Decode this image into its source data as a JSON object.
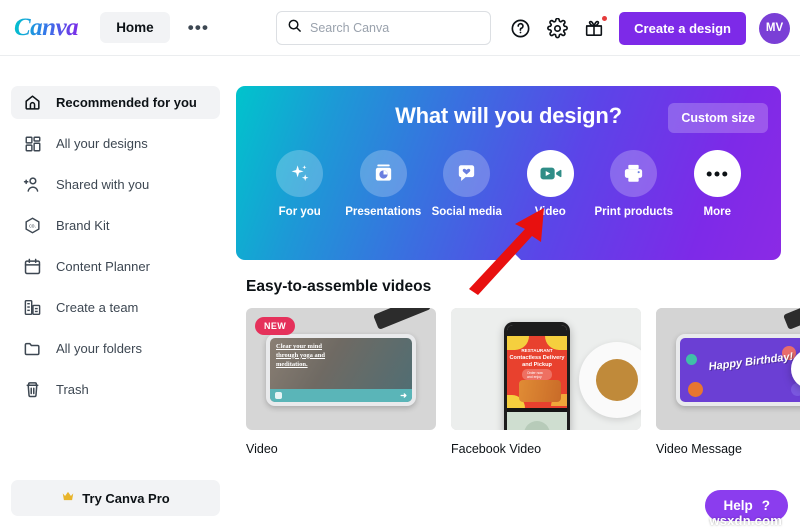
{
  "header": {
    "logo_text": "Canva",
    "nav_home": "Home",
    "nav_more": "•••",
    "search": {
      "value": "",
      "placeholder": "Search Canva"
    },
    "icons": [
      {
        "name": "help-circle-icon",
        "label": "?"
      },
      {
        "name": "gear-icon",
        "label": "settings"
      },
      {
        "name": "gift-icon",
        "label": "gift"
      }
    ],
    "create_button": "Create a design",
    "avatar_initials": "MV"
  },
  "sidebar": {
    "items": [
      {
        "label": "Recommended for you",
        "icon": "home-icon",
        "active": true
      },
      {
        "label": "All your designs",
        "icon": "grid-icon",
        "active": false
      },
      {
        "label": "Shared with you",
        "icon": "add-user-icon",
        "active": false
      },
      {
        "label": "Brand Kit",
        "icon": "brand-hexagon-icon",
        "active": false
      },
      {
        "label": "Content Planner",
        "icon": "calendar-icon",
        "active": false
      },
      {
        "label": "Create a team",
        "icon": "building-icon",
        "active": false
      },
      {
        "label": "All your folders",
        "icon": "folder-icon",
        "active": false
      },
      {
        "label": "Trash",
        "icon": "trash-icon",
        "active": false
      }
    ],
    "pro_button": {
      "label": "Try Canva Pro",
      "icon": "crown-icon"
    }
  },
  "hero": {
    "title": "What will you design?",
    "custom_size_button": "Custom size",
    "gradient_from": "#00c4cc",
    "gradient_to": "#7d2ae8",
    "categories": [
      {
        "label": "For you",
        "icon": "sparkles-icon",
        "active": false
      },
      {
        "label": "Presentations",
        "icon": "presentation-icon",
        "active": false
      },
      {
        "label": "Social media",
        "icon": "heart-bubble-icon",
        "active": false
      },
      {
        "label": "Video",
        "icon": "video-camera-icon",
        "active": true
      },
      {
        "label": "Print products",
        "icon": "printer-icon",
        "active": false
      },
      {
        "label": "More",
        "icon": "ellipsis-icon",
        "active": true
      }
    ]
  },
  "section": {
    "title": "Easy-to-assemble videos",
    "cards": [
      {
        "label": "Video",
        "badge": "NEW",
        "thumb_text": "Clear your mind through yoga and meditation."
      },
      {
        "label": "Facebook Video",
        "badge": "",
        "thumb_text": "Contactless Delivery and Pickup",
        "thumb_subtext": "Order now and enjoy",
        "thumb_brand": "RESTAURANT"
      },
      {
        "label": "Video Message",
        "badge": "",
        "thumb_text": "Happy Birthday!"
      }
    ],
    "next_arrow": "›"
  },
  "help": {
    "label": "Help",
    "mark": "?"
  },
  "watermark": "wsxdn.com",
  "annotation": {
    "type": "red-arrow",
    "points_to": "Video"
  }
}
